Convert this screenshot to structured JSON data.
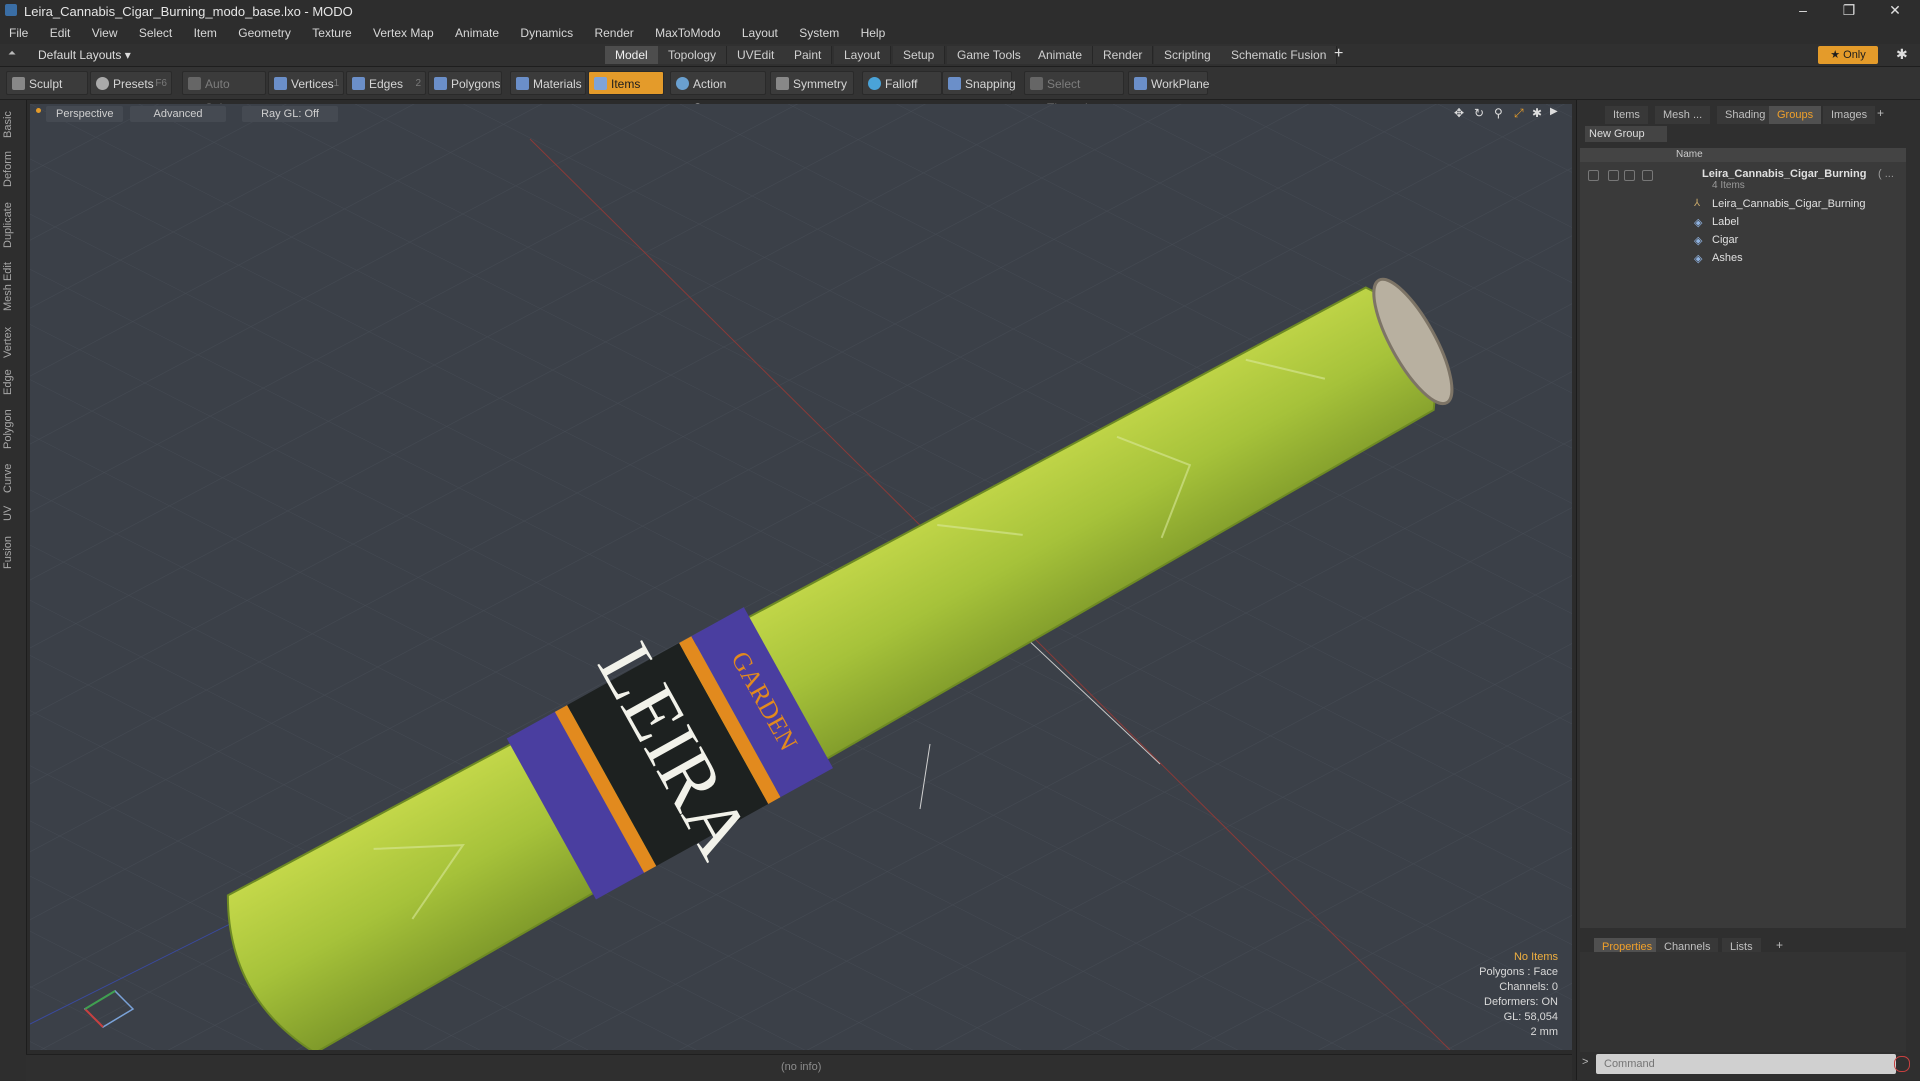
{
  "window": {
    "title": "Leira_Cannabis_Cigar_Burning_modo_base.lxo - MODO",
    "minimize_glyph": "–",
    "maximize_glyph": "❐",
    "close_glyph": "✕"
  },
  "menu": [
    "File",
    "Edit",
    "View",
    "Select",
    "Item",
    "Geometry",
    "Texture",
    "Vertex Map",
    "Animate",
    "Dynamics",
    "Render",
    "MaxToModo",
    "Layout",
    "System",
    "Help"
  ],
  "layout_row": {
    "layouts_label": "Default Layouts ▾",
    "tabs": [
      "Model",
      "Topology",
      "UVEdit",
      "Paint",
      "Layout",
      "Setup",
      "Game Tools",
      "Animate",
      "Render",
      "Scripting",
      "Schematic Fusion"
    ],
    "active_tab": "Model",
    "add_tab": "+",
    "only_label": "★  Only",
    "gear_glyph": "✱"
  },
  "toolbar": {
    "sculpt": "Sculpt",
    "presets": "Presets",
    "presets_key": "F6",
    "auto_select": "Auto Select",
    "vertices": "Vertices",
    "vertices_num": "1",
    "edges": "Edges",
    "edges_num": "2",
    "polygons": "Polygons",
    "materials": "Materials",
    "items": "Items",
    "action_center": "Action Center",
    "symmetry": "Symmetry",
    "falloff": "Falloff",
    "snapping": "Snapping",
    "select_through": "Select Through",
    "workplane": "WorkPlane"
  },
  "left_tabs": [
    "Basic",
    "Deform",
    "Duplicate",
    "Mesh Edit",
    "Vertex",
    "Edge",
    "Polygon",
    "Curve",
    "UV",
    "Fusion"
  ],
  "viewport": {
    "view_label": "Perspective",
    "shading_label": "Advanced",
    "raygl_label": "Ray GL: Off",
    "label_text_big": "LEIRA",
    "label_text_small": "GARDEN",
    "stats": {
      "items": "No Items",
      "polygons": "Polygons : Face",
      "channels": "Channels: 0",
      "deformers": "Deformers: ON",
      "gl": "GL: 58,054",
      "scale": "2 mm"
    }
  },
  "status": "(no info)",
  "right_panel": {
    "tabs": [
      "Items",
      "Mesh ...",
      "Shading",
      "Groups",
      "Images"
    ],
    "active_tab": "Groups",
    "new_group": "New Group",
    "name_header": "Name",
    "group": {
      "name": "Leira_Cannabis_Cigar_Burning",
      "suffix": "( ...",
      "count": "4 Items"
    },
    "children": [
      "Leira_Cannabis_Cigar_Burning",
      "Label",
      "Cigar",
      "Ashes"
    ],
    "bottom_tabs": [
      "Properties",
      "Channels",
      "Lists"
    ],
    "bottom_active": "Properties",
    "add": "+",
    "command_placeholder": "Command",
    "command_prompt": ">"
  },
  "colors": {
    "accent": "#e49b2a",
    "viewport_bg": "#3b4048",
    "leaf_green": "#a8c43c",
    "band_purple": "#4a3ea0",
    "band_orange": "#e28a1e"
  }
}
